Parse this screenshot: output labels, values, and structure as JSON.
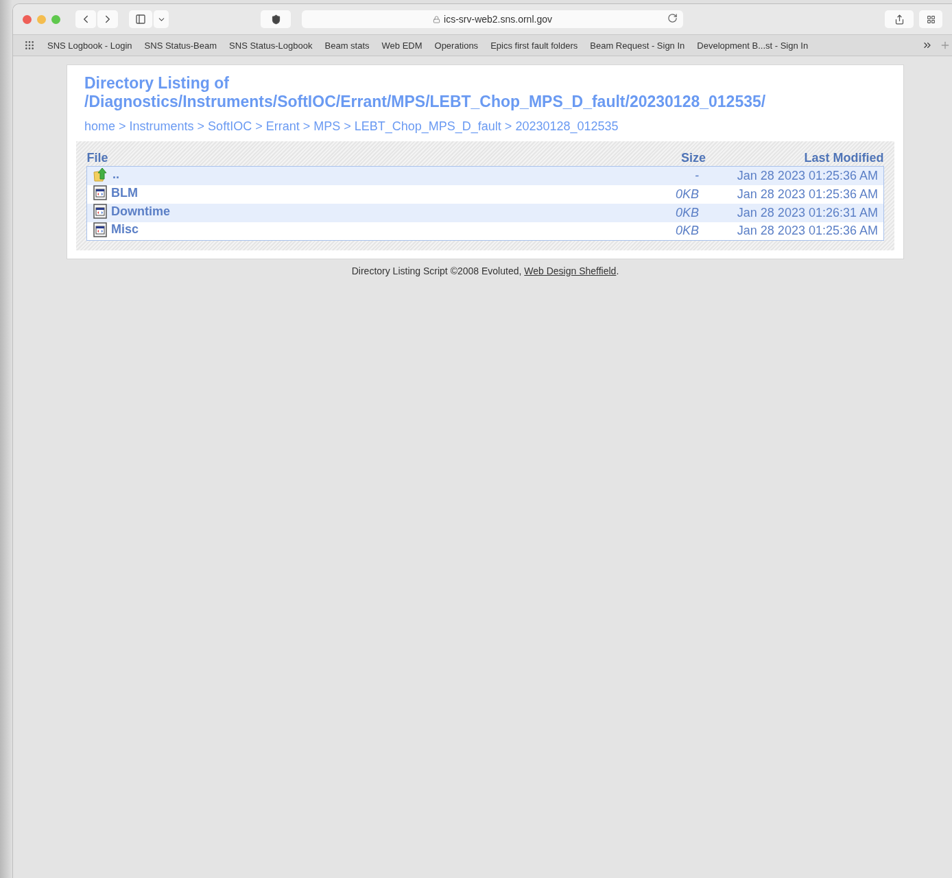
{
  "browser": {
    "url": "ics-srv-web2.sns.ornl.gov"
  },
  "bookmarks": [
    "SNS Logbook - Login",
    "SNS Status-Beam",
    "SNS Status-Logbook",
    "Beam stats",
    "Web EDM",
    "Operations",
    "Epics first fault folders",
    "Beam Request - Sign In",
    "Development B...st - Sign In"
  ],
  "page": {
    "title_line_1": "Directory Listing of",
    "title_line_2": "/Diagnostics/Instruments/SoftIOC/Errant/MPS/LEBT_Chop_MPS_D_fault/20230128_012535/",
    "breadcrumb": {
      "separator": ">",
      "items": [
        "home",
        "Instruments",
        "SoftIOC",
        "Errant",
        "MPS",
        "LEBT_Chop_MPS_D_fault",
        "20230128_012535"
      ]
    },
    "table": {
      "columns": [
        "File",
        "Size",
        "Last Modified"
      ],
      "rows": [
        {
          "kind": "parent",
          "name": "..",
          "size": "-",
          "modified": "Jan 28 2023 01:25:36 AM"
        },
        {
          "kind": "file",
          "name": "BLM",
          "size": "0KB",
          "modified": "Jan 28 2023 01:25:36 AM"
        },
        {
          "kind": "file",
          "name": "Downtime",
          "size": "0KB",
          "modified": "Jan 28 2023 01:26:31 AM"
        },
        {
          "kind": "file",
          "name": "Misc",
          "size": "0KB",
          "modified": "Jan 28 2023 01:25:36 AM"
        }
      ]
    }
  },
  "footer": {
    "text": "Directory Listing Script ©2008 Evoluted, ",
    "link": "Web Design Sheffield",
    "text_after": "."
  }
}
